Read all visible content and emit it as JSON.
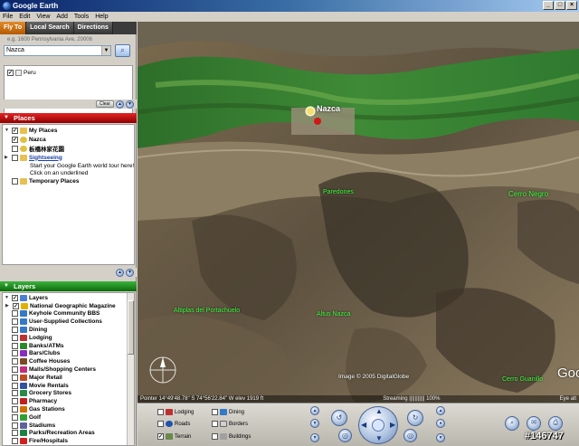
{
  "window": {
    "title": "Google Earth"
  },
  "menu": [
    "File",
    "Edit",
    "View",
    "Add",
    "Tools",
    "Help"
  ],
  "search": {
    "tabs": [
      "Fly To",
      "Local Search",
      "Directions"
    ],
    "hint": "e.g. 1600 Pennsylvania Ave, 20006",
    "query": "Nazca",
    "results": [
      "Peru"
    ],
    "clear_label": "Clear"
  },
  "places": {
    "header": "Places",
    "items": [
      {
        "label": "My Places",
        "checked": true,
        "bold": true
      },
      {
        "label": "Nazca",
        "checked": true,
        "bold": true
      },
      {
        "label": "板橋林家花園",
        "checked": false,
        "bold": true
      },
      {
        "label": "Sightseeing",
        "checked": false,
        "link": true
      },
      {
        "label": "Start your Google Earth world tour here!"
      },
      {
        "label": "Click on an underlined"
      },
      {
        "label": "Temporary Places",
        "checked": false,
        "bold": true
      }
    ]
  },
  "layers": {
    "header": "Layers",
    "items": [
      {
        "label": "Layers",
        "checked": true,
        "color": "#4a7fd6"
      },
      {
        "label": "National Geographic Magazine",
        "checked": true,
        "color": "#e0b000"
      },
      {
        "label": "Keyhole Community BBS",
        "checked": false,
        "color": "#3478c8"
      },
      {
        "label": "User-Supplied Collections",
        "checked": false,
        "color": "#3478c8"
      },
      {
        "label": "Dining",
        "checked": false,
        "color": "#3478c8"
      },
      {
        "label": "Lodging",
        "checked": false,
        "color": "#c03030"
      },
      {
        "label": "Banks/ATMs",
        "checked": false,
        "color": "#2a8a2a"
      },
      {
        "label": "Bars/Clubs",
        "checked": false,
        "color": "#8a2ac0"
      },
      {
        "label": "Coffee Houses",
        "checked": false,
        "color": "#7a4a20"
      },
      {
        "label": "Malls/Shopping Centers",
        "checked": false,
        "color": "#c0307a"
      },
      {
        "label": "Major Retail",
        "checked": false,
        "color": "#c04a20"
      },
      {
        "label": "Movie Rentals",
        "checked": false,
        "color": "#3050a0"
      },
      {
        "label": "Grocery Stores",
        "checked": false,
        "color": "#2a8a4a"
      },
      {
        "label": "Pharmacy",
        "checked": false,
        "color": "#c02020"
      },
      {
        "label": "Gas Stations",
        "checked": false,
        "color": "#d07000"
      },
      {
        "label": "Golf",
        "checked": false,
        "color": "#30a030"
      },
      {
        "label": "Stadiums",
        "checked": false,
        "color": "#6060a0"
      },
      {
        "label": "Parks/Recreation Areas",
        "checked": false,
        "color": "#208040"
      },
      {
        "label": "Fire/Hospitals",
        "checked": false,
        "color": "#d02020"
      }
    ]
  },
  "map": {
    "labels": [
      {
        "text": "Nazca",
        "color": "#ffffff"
      },
      {
        "text": "Paredones",
        "color": "#40ff40"
      },
      {
        "text": "Cerro Negro",
        "color": "#40ff40"
      },
      {
        "text": "Altiplas del Portachuelo",
        "color": "#40ff40"
      },
      {
        "text": "Altus Nazca",
        "color": "#40ff40"
      },
      {
        "text": "Cerro Guanillo",
        "color": "#40ff40"
      }
    ],
    "credit": "Image © 2005 DigitalGlobe",
    "logo": "Goo",
    "status": {
      "pointer": "Pointer 14°49'48.78\" S 74°56'22.84\" W elev 1919 ft",
      "streaming": "Streaming ||||||||||| 100%",
      "eye": "Eye alt"
    }
  },
  "controls": {
    "layers": [
      {
        "label": "Lodging",
        "checked": false
      },
      {
        "label": "Dining",
        "checked": false
      },
      {
        "label": "Roads",
        "checked": false
      },
      {
        "label": "Borders",
        "checked": false
      },
      {
        "label": "Terrain",
        "checked": true
      },
      {
        "label": "Buildings",
        "checked": false
      }
    ]
  },
  "watermark": "#146747",
  "colors": {
    "places_header": "#c00000",
    "layers_header": "#1e8a1e",
    "active_tab": "#d07a18"
  }
}
